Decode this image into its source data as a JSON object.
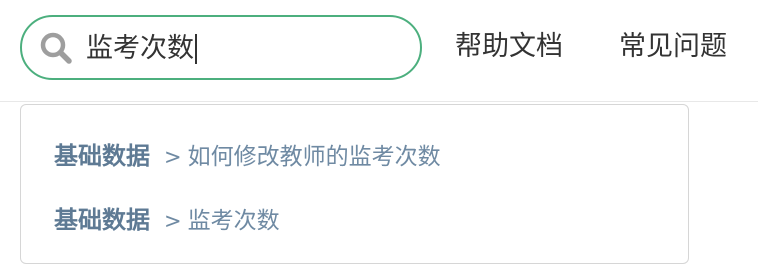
{
  "header": {
    "search": {
      "value": "监考次数",
      "placeholder": ""
    },
    "nav": {
      "help_docs": "帮助文档",
      "faq": "常见问题"
    }
  },
  "dropdown": {
    "suggestions": [
      {
        "category": "基础数据",
        "separator": ">",
        "title": "如何修改教师的监考次数"
      },
      {
        "category": "基础数据",
        "separator": ">",
        "title": "监考次数"
      }
    ]
  },
  "colors": {
    "search_border": "#4caf7e",
    "category_text": "#5e7a94",
    "suggestion_text": "#6f8aa3",
    "icon": "#9e9e9e"
  },
  "icons": {
    "search": "search-icon"
  }
}
